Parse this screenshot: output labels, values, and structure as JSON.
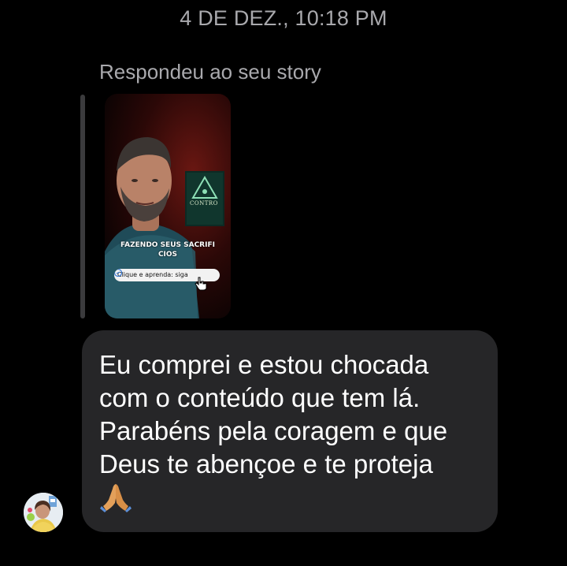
{
  "header": {
    "timestamp": "4 DE DEZ., 10:18 PM"
  },
  "reply": {
    "caption": "Respondeu ao seu story",
    "story": {
      "caption_text": "FAZENDO SEUS SACRIFI\nCIOS",
      "link_label": "Clique e aprenda: siga",
      "book_title": "CONTRO"
    }
  },
  "message": {
    "text": "Eu comprei e estou chocada\ncom o conteúdo que tem lá.\nParabéns pela coragem e que\nDeus te abençoe e te proteja",
    "emoji": "folded-hands-icon"
  },
  "sender": {
    "avatar": "avatar-photo"
  },
  "colors": {
    "background": "#000000",
    "bubble": "#262628",
    "muted_text": "#a9a9ad",
    "reply_bar": "#3b3b3d"
  }
}
